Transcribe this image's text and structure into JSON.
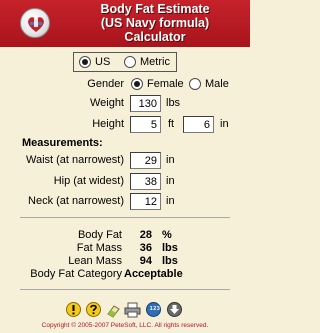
{
  "header": {
    "title_line1": "Body Fat Estimate",
    "title_line2": "(US Navy formula)",
    "title_line3": "Calculator"
  },
  "units": {
    "us_label": "US",
    "metric_label": "Metric",
    "selected": "US"
  },
  "gender": {
    "label": "Gender",
    "female_label": "Female",
    "male_label": "Male",
    "selected": "Female"
  },
  "weight": {
    "label": "Weight",
    "value": "130",
    "unit": "lbs"
  },
  "height": {
    "label": "Height",
    "feet": "5",
    "feet_unit": "ft",
    "inches": "6",
    "inches_unit": "in"
  },
  "measurements": {
    "heading": "Measurements:",
    "waist": {
      "label": "Waist (at narrowest)",
      "value": "29",
      "unit": "in"
    },
    "hip": {
      "label": "Hip (at widest)",
      "value": "38",
      "unit": "in"
    },
    "neck": {
      "label": "Neck (at narrowest)",
      "value": "12",
      "unit": "in"
    }
  },
  "results": {
    "body_fat": {
      "label": "Body Fat",
      "value": "28",
      "unit": "%"
    },
    "fat_mass": {
      "label": "Fat Mass",
      "value": "36",
      "unit": "lbs"
    },
    "lean_mass": {
      "label": "Lean Mass",
      "value": "94",
      "unit": "lbs"
    },
    "category": {
      "label": "Body Fat Category",
      "value": "Acceptable"
    }
  },
  "toolbar": {
    "icons": [
      "info-icon",
      "help-icon",
      "eraser-icon",
      "printer-icon",
      "calculator-icon",
      "download-icon"
    ],
    "calculator_glyph": "1 2 3"
  },
  "footer": {
    "copyright": "Copyright © 2005-2007 PeteSoft, LLC. All rights reserved."
  },
  "colors": {
    "header": "#b81c24",
    "background": "#f6f0d8",
    "copyright": "#b0181f"
  }
}
